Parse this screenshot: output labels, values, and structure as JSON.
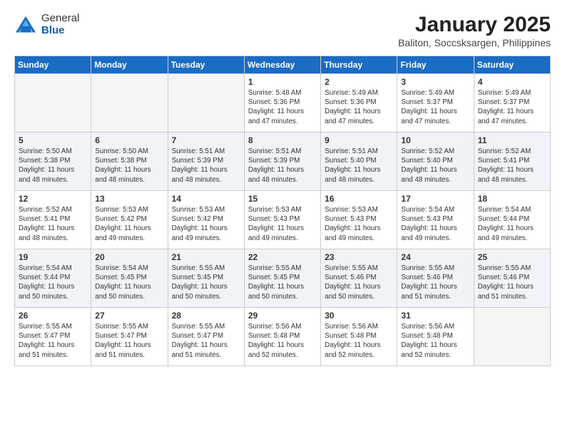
{
  "logo": {
    "general": "General",
    "blue": "Blue"
  },
  "title": "January 2025",
  "subtitle": "Baliton, Soccsksargen, Philippines",
  "days_header": [
    "Sunday",
    "Monday",
    "Tuesday",
    "Wednesday",
    "Thursday",
    "Friday",
    "Saturday"
  ],
  "weeks": [
    [
      {
        "num": "",
        "info": ""
      },
      {
        "num": "",
        "info": ""
      },
      {
        "num": "",
        "info": ""
      },
      {
        "num": "1",
        "info": "Sunrise: 5:48 AM\nSunset: 5:36 PM\nDaylight: 11 hours\nand 47 minutes."
      },
      {
        "num": "2",
        "info": "Sunrise: 5:49 AM\nSunset: 5:36 PM\nDaylight: 11 hours\nand 47 minutes."
      },
      {
        "num": "3",
        "info": "Sunrise: 5:49 AM\nSunset: 5:37 PM\nDaylight: 11 hours\nand 47 minutes."
      },
      {
        "num": "4",
        "info": "Sunrise: 5:49 AM\nSunset: 5:37 PM\nDaylight: 11 hours\nand 47 minutes."
      }
    ],
    [
      {
        "num": "5",
        "info": "Sunrise: 5:50 AM\nSunset: 5:38 PM\nDaylight: 11 hours\nand 48 minutes."
      },
      {
        "num": "6",
        "info": "Sunrise: 5:50 AM\nSunset: 5:38 PM\nDaylight: 11 hours\nand 48 minutes."
      },
      {
        "num": "7",
        "info": "Sunrise: 5:51 AM\nSunset: 5:39 PM\nDaylight: 11 hours\nand 48 minutes."
      },
      {
        "num": "8",
        "info": "Sunrise: 5:51 AM\nSunset: 5:39 PM\nDaylight: 11 hours\nand 48 minutes."
      },
      {
        "num": "9",
        "info": "Sunrise: 5:51 AM\nSunset: 5:40 PM\nDaylight: 11 hours\nand 48 minutes."
      },
      {
        "num": "10",
        "info": "Sunrise: 5:52 AM\nSunset: 5:40 PM\nDaylight: 11 hours\nand 48 minutes."
      },
      {
        "num": "11",
        "info": "Sunrise: 5:52 AM\nSunset: 5:41 PM\nDaylight: 11 hours\nand 48 minutes."
      }
    ],
    [
      {
        "num": "12",
        "info": "Sunrise: 5:52 AM\nSunset: 5:41 PM\nDaylight: 11 hours\nand 48 minutes."
      },
      {
        "num": "13",
        "info": "Sunrise: 5:53 AM\nSunset: 5:42 PM\nDaylight: 11 hours\nand 49 minutes."
      },
      {
        "num": "14",
        "info": "Sunrise: 5:53 AM\nSunset: 5:42 PM\nDaylight: 11 hours\nand 49 minutes."
      },
      {
        "num": "15",
        "info": "Sunrise: 5:53 AM\nSunset: 5:43 PM\nDaylight: 11 hours\nand 49 minutes."
      },
      {
        "num": "16",
        "info": "Sunrise: 5:53 AM\nSunset: 5:43 PM\nDaylight: 11 hours\nand 49 minutes."
      },
      {
        "num": "17",
        "info": "Sunrise: 5:54 AM\nSunset: 5:43 PM\nDaylight: 11 hours\nand 49 minutes."
      },
      {
        "num": "18",
        "info": "Sunrise: 5:54 AM\nSunset: 5:44 PM\nDaylight: 11 hours\nand 49 minutes."
      }
    ],
    [
      {
        "num": "19",
        "info": "Sunrise: 5:54 AM\nSunset: 5:44 PM\nDaylight: 11 hours\nand 50 minutes."
      },
      {
        "num": "20",
        "info": "Sunrise: 5:54 AM\nSunset: 5:45 PM\nDaylight: 11 hours\nand 50 minutes."
      },
      {
        "num": "21",
        "info": "Sunrise: 5:55 AM\nSunset: 5:45 PM\nDaylight: 11 hours\nand 50 minutes."
      },
      {
        "num": "22",
        "info": "Sunrise: 5:55 AM\nSunset: 5:45 PM\nDaylight: 11 hours\nand 50 minutes."
      },
      {
        "num": "23",
        "info": "Sunrise: 5:55 AM\nSunset: 5:46 PM\nDaylight: 11 hours\nand 50 minutes."
      },
      {
        "num": "24",
        "info": "Sunrise: 5:55 AM\nSunset: 5:46 PM\nDaylight: 11 hours\nand 51 minutes."
      },
      {
        "num": "25",
        "info": "Sunrise: 5:55 AM\nSunset: 5:46 PM\nDaylight: 11 hours\nand 51 minutes."
      }
    ],
    [
      {
        "num": "26",
        "info": "Sunrise: 5:55 AM\nSunset: 5:47 PM\nDaylight: 11 hours\nand 51 minutes."
      },
      {
        "num": "27",
        "info": "Sunrise: 5:55 AM\nSunset: 5:47 PM\nDaylight: 11 hours\nand 51 minutes."
      },
      {
        "num": "28",
        "info": "Sunrise: 5:55 AM\nSunset: 5:47 PM\nDaylight: 11 hours\nand 51 minutes."
      },
      {
        "num": "29",
        "info": "Sunrise: 5:56 AM\nSunset: 5:48 PM\nDaylight: 11 hours\nand 52 minutes."
      },
      {
        "num": "30",
        "info": "Sunrise: 5:56 AM\nSunset: 5:48 PM\nDaylight: 11 hours\nand 52 minutes."
      },
      {
        "num": "31",
        "info": "Sunrise: 5:56 AM\nSunset: 5:48 PM\nDaylight: 11 hours\nand 52 minutes."
      },
      {
        "num": "",
        "info": ""
      }
    ]
  ]
}
